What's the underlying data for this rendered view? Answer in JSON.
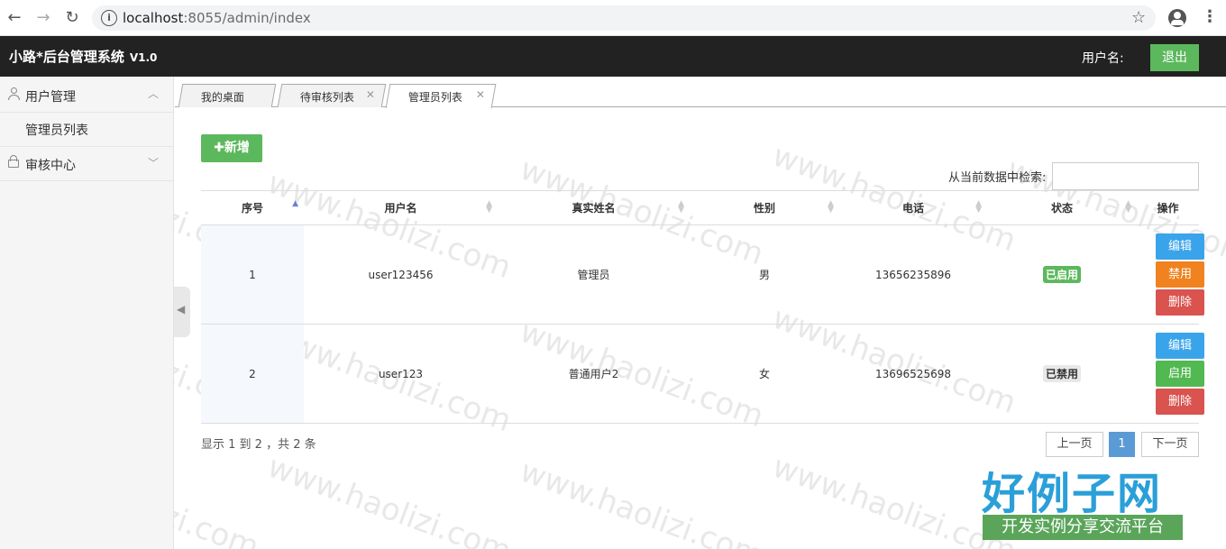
{
  "browser": {
    "url_host": "localhost",
    "url_rest": ":8055/admin/index"
  },
  "header": {
    "title": "小路*后台管理系统",
    "version": "V1.0",
    "user_label": "用户名:",
    "logout_label": "退出"
  },
  "sidebar": {
    "groups": [
      {
        "label": "用户管理",
        "items": [
          {
            "label": "管理员列表"
          }
        ]
      },
      {
        "label": "审核中心",
        "items": []
      }
    ]
  },
  "tabs": [
    {
      "label": "我的桌面",
      "closable": false
    },
    {
      "label": "待审核列表",
      "closable": true
    },
    {
      "label": "管理员列表",
      "closable": true,
      "active": true
    }
  ],
  "toolbar": {
    "add_label": "✚新增",
    "search_label": "从当前数据中检索:",
    "search_value": ""
  },
  "table": {
    "columns": [
      "序号",
      "用户名",
      "真实姓名",
      "性别",
      "电话",
      "状态",
      "操作"
    ],
    "rows": [
      {
        "idx": "1",
        "username": "user123456",
        "realname": "管理员",
        "gender": "男",
        "phone": "13656235896",
        "status": "已启用",
        "actions": [
          "编辑",
          "禁用",
          "删除"
        ]
      },
      {
        "idx": "2",
        "username": "user123",
        "realname": "普通用户2",
        "gender": "女",
        "phone": "13696525698",
        "status": "已禁用",
        "actions": [
          "编辑",
          "启用",
          "删除"
        ]
      }
    ]
  },
  "footer": {
    "summary": "显示 1 到 2 ，共 2 条",
    "prev": "上一页",
    "page": "1",
    "next": "下一页"
  },
  "watermark": {
    "text": "www.haolizi.com",
    "logo_main": "好例子网",
    "logo_sub": "开发实例分享交流平台"
  },
  "colors": {
    "header_bg": "#222222",
    "success": "#5cb85c",
    "info": "#3aa4ea",
    "warning": "#f0821f",
    "danger": "#d9534f",
    "page_active": "#5b9bd5"
  }
}
